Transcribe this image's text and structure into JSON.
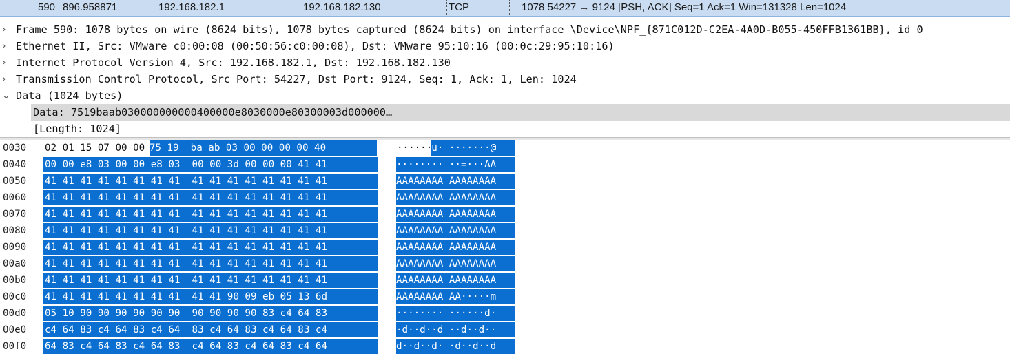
{
  "packet_list": {
    "row": {
      "no": "590",
      "time": "896.958871",
      "source": "192.168.182.1",
      "destination": "192.168.182.130",
      "protocol": "TCP",
      "info": "1078 54227 → 9124 [PSH, ACK] Seq=1 Ack=1 Win=131328 Len=1024"
    },
    "row_color": "#c9dcf2"
  },
  "details": {
    "frame": "Frame 590: 1078 bytes on wire (8624 bits), 1078 bytes captured (8624 bits) on interface \\Device\\NPF_{871C012D-C2EA-4A0D-B055-450FFB1361BB}, id 0",
    "ethernet": "Ethernet II, Src: VMware_c0:00:08 (00:50:56:c0:00:08), Dst: VMware_95:10:16 (00:0c:29:95:10:16)",
    "ip": "Internet Protocol Version 4, Src: 192.168.182.1, Dst: 192.168.182.130",
    "tcp": "Transmission Control Protocol, Src Port: 54227, Dst Port: 9124, Seq: 1, Ack: 1, Len: 1024",
    "data": "Data (1024 bytes)",
    "data_child": "Data: 7519baab030000000000400000e8030000e80300003d000000…",
    "length_child": "[Length: 1024]",
    "collapsed_arrow": ">",
    "expanded_arrow": "v"
  },
  "hex_dump": {
    "selection_color": "#0a6fd1",
    "rows": [
      {
        "offset": "0030",
        "hex_plain": "02 01 15 07 00 00 ",
        "hex_sel": "75 19  ba ab 03 00 00 00 00 40",
        "ascii_plain": "······",
        "ascii_sel": "u· ·······@"
      },
      {
        "offset": "0040",
        "hex_plain": "",
        "hex_sel": "00 00 e8 03 00 00 e8 03  00 00 3d 00 00 00 41 41",
        "ascii_plain": "",
        "ascii_sel": "········ ··=···AA"
      },
      {
        "offset": "0050",
        "hex_plain": "",
        "hex_sel": "41 41 41 41 41 41 41 41  41 41 41 41 41 41 41 41",
        "ascii_plain": "",
        "ascii_sel": "AAAAAAAA AAAAAAAA"
      },
      {
        "offset": "0060",
        "hex_plain": "",
        "hex_sel": "41 41 41 41 41 41 41 41  41 41 41 41 41 41 41 41",
        "ascii_plain": "",
        "ascii_sel": "AAAAAAAA AAAAAAAA"
      },
      {
        "offset": "0070",
        "hex_plain": "",
        "hex_sel": "41 41 41 41 41 41 41 41  41 41 41 41 41 41 41 41",
        "ascii_plain": "",
        "ascii_sel": "AAAAAAAA AAAAAAAA"
      },
      {
        "offset": "0080",
        "hex_plain": "",
        "hex_sel": "41 41 41 41 41 41 41 41  41 41 41 41 41 41 41 41",
        "ascii_plain": "",
        "ascii_sel": "AAAAAAAA AAAAAAAA"
      },
      {
        "offset": "0090",
        "hex_plain": "",
        "hex_sel": "41 41 41 41 41 41 41 41  41 41 41 41 41 41 41 41",
        "ascii_plain": "",
        "ascii_sel": "AAAAAAAA AAAAAAAA"
      },
      {
        "offset": "00a0",
        "hex_plain": "",
        "hex_sel": "41 41 41 41 41 41 41 41  41 41 41 41 41 41 41 41",
        "ascii_plain": "",
        "ascii_sel": "AAAAAAAA AAAAAAAA"
      },
      {
        "offset": "00b0",
        "hex_plain": "",
        "hex_sel": "41 41 41 41 41 41 41 41  41 41 41 41 41 41 41 41",
        "ascii_plain": "",
        "ascii_sel": "AAAAAAAA AAAAAAAA"
      },
      {
        "offset": "00c0",
        "hex_plain": "",
        "hex_sel": "41 41 41 41 41 41 41 41  41 41 90 09 eb 05 13 6d",
        "ascii_plain": "",
        "ascii_sel": "AAAAAAAA AA·····m"
      },
      {
        "offset": "00d0",
        "hex_plain": "",
        "hex_sel": "05 10 90 90 90 90 90 90  90 90 90 90 83 c4 64 83",
        "ascii_plain": "",
        "ascii_sel": "········ ······d·"
      },
      {
        "offset": "00e0",
        "hex_plain": "",
        "hex_sel": "c4 64 83 c4 64 83 c4 64  83 c4 64 83 c4 64 83 c4",
        "ascii_plain": "",
        "ascii_sel": "·d··d··d ··d··d··"
      },
      {
        "offset": "00f0",
        "hex_plain": "",
        "hex_sel": "64 83 c4 64 83 c4 64 83  c4 64 83 c4 64 83 c4 64",
        "ascii_plain": "",
        "ascii_sel": "d··d··d· ·d··d··d"
      }
    ]
  }
}
